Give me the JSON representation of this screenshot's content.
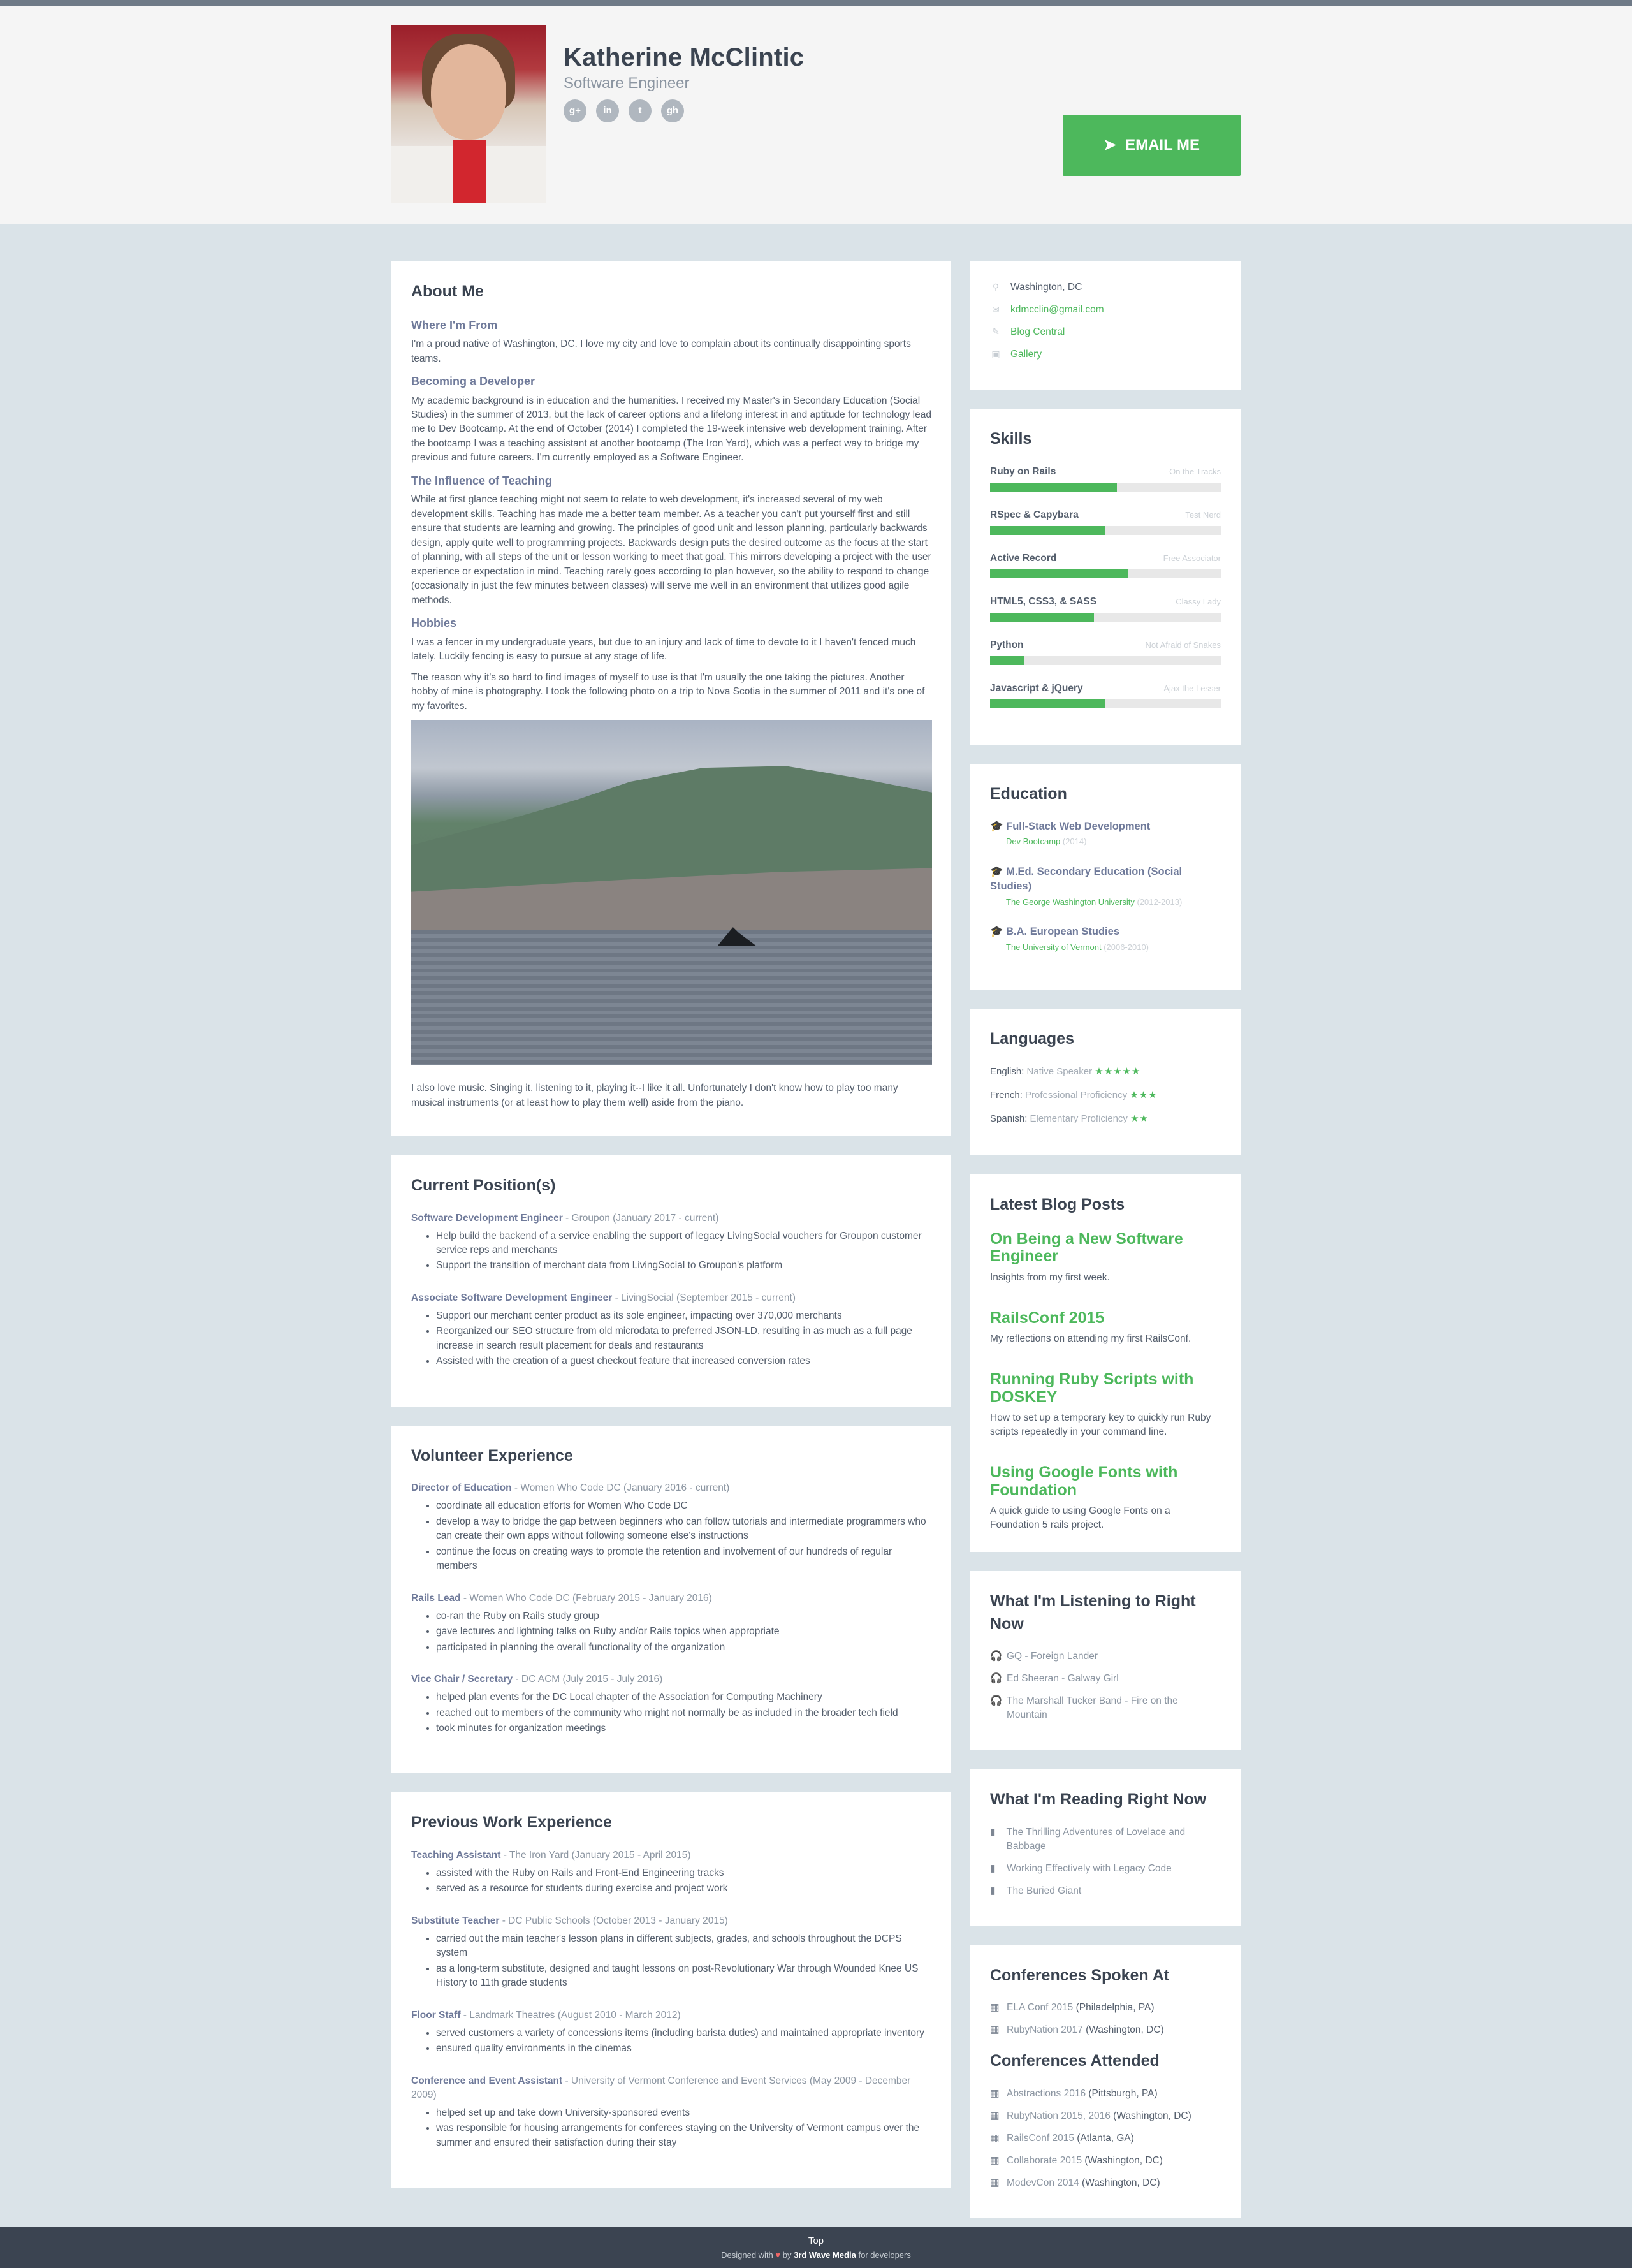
{
  "header": {
    "name": "Katherine McClintic",
    "tagline": "Software Engineer",
    "email_button": "EMAIL ME",
    "social": [
      "g+",
      "in",
      "t",
      "gh"
    ]
  },
  "about": {
    "title": "About Me",
    "sections": [
      {
        "h": "Where I'm From",
        "p": [
          "I'm a proud native of Washington, DC. I love my city and love to complain about its continually disappointing sports teams."
        ]
      },
      {
        "h": "Becoming a Developer",
        "p": [
          "My academic background is in education and the humanities. I received my Master's in Secondary Education (Social Studies) in the summer of 2013, but the lack of career options and a lifelong interest in and aptitude for technology lead me to Dev Bootcamp. At the end of October (2014) I completed the 19-week intensive web development training. After the bootcamp I was a teaching assistant at another bootcamp (The Iron Yard), which was a perfect way to bridge my previous and future careers. I'm currently employed as a Software Engineer."
        ]
      },
      {
        "h": "The Influence of Teaching",
        "p": [
          "While at first glance teaching might not seem to relate to web development, it's increased several of my web development skills. Teaching has made me a better team member. As a teacher you can't put yourself first and still ensure that students are learning and growing. The principles of good unit and lesson planning, particularly backwards design, apply quite well to programming projects. Backwards design puts the desired outcome as the focus at the start of planning, with all steps of the unit or lesson working to meet that goal. This mirrors developing a project with the user experience or expectation in mind. Teaching rarely goes according to plan however, so the ability to respond to change (occasionally in just the few minutes between classes) will serve me well in an environment that utilizes good agile methods."
        ]
      },
      {
        "h": "Hobbies",
        "p": [
          "I was a fencer in my undergraduate years, but due to an injury and lack of time to devote to it I haven't fenced much lately. Luckily fencing is easy to pursue at any stage of life.",
          "The reason why it's so hard to find images of myself to use is that I'm usually the one taking the pictures. Another hobby of mine is photography. I took the following photo on a trip to Nova Scotia in the summer of 2011 and it's one of my favorites."
        ]
      }
    ],
    "after_photo": "I also love music. Singing it, listening to it, playing it--I like it all. Unfortunately I don't know how to play too many musical instruments (or at least how to play them well) aside from the piano."
  },
  "current": {
    "title": "Current Position(s)",
    "jobs": [
      {
        "role": "Software Development Engineer",
        "org": " - Groupon (January 2017 - current)",
        "items": [
          "Help build the backend of a service enabling the support of legacy LivingSocial vouchers for Groupon customer service reps and merchants",
          "Support the transition of merchant data from LivingSocial to Groupon's platform"
        ]
      },
      {
        "role": "Associate Software Development Engineer",
        "org": " - LivingSocial (September 2015 - current)",
        "items": [
          "Support our merchant center product as its sole engineer, impacting over 370,000 merchants",
          "Reorganized our SEO structure from old microdata to preferred JSON-LD, resulting in as much as a full page increase in search result placement for deals and restaurants",
          "Assisted with the creation of a guest checkout feature that increased conversion rates"
        ]
      }
    ]
  },
  "volunteer": {
    "title": "Volunteer Experience",
    "jobs": [
      {
        "role": "Director of Education",
        "org": " - Women Who Code DC (January 2016 - current)",
        "items": [
          "coordinate all education efforts for Women Who Code DC",
          "develop a way to bridge the gap between beginners who can follow tutorials and intermediate programmers who can create their own apps without following someone else's instructions",
          "continue the focus on creating ways to promote the retention and involvement of our hundreds of regular members"
        ]
      },
      {
        "role": "Rails Lead",
        "org": " - Women Who Code DC (February 2015 - January 2016)",
        "items": [
          "co-ran the Ruby on Rails study group",
          "gave lectures and lightning talks on Ruby and/or Rails topics when appropriate",
          "participated in planning the overall functionality of the organization"
        ]
      },
      {
        "role": "Vice Chair / Secretary",
        "org": " - DC ACM (July 2015 - July 2016)",
        "items": [
          "helped plan events for the DC Local chapter of the Association for Computing Machinery",
          "reached out to members of the community who might not normally be as included in the broader tech field",
          "took minutes for organization meetings"
        ]
      }
    ]
  },
  "previous": {
    "title": "Previous Work Experience",
    "jobs": [
      {
        "role": "Teaching Assistant",
        "org": " - The Iron Yard (January 2015 - April 2015)",
        "items": [
          "assisted with the Ruby on Rails and Front-End Engineering tracks",
          "served as a resource for students during exercise and project work"
        ]
      },
      {
        "role": "Substitute Teacher",
        "org": " - DC Public Schools (October 2013 - January 2015)",
        "items": [
          "carried out the main teacher's lesson plans in different subjects, grades, and schools throughout the DCPS system",
          "as a long-term substitute, designed and taught lessons on post-Revolutionary War through Wounded Knee US History to 11th grade students"
        ]
      },
      {
        "role": "Floor Staff",
        "org": " - Landmark Theatres (August 2010 - March 2012)",
        "items": [
          "served customers a variety of concessions items (including barista duties) and maintained appropriate inventory",
          "ensured quality environments in the cinemas"
        ]
      },
      {
        "role": "Conference and Event Assistant",
        "org": " - University of Vermont Conference and Event Services (May 2009 - December 2009)",
        "items": [
          "helped set up and take down University-sponsored events",
          "was responsible for housing arrangements for conferees staying on the University of Vermont campus over the summer and ensured their satisfaction during their stay"
        ]
      }
    ]
  },
  "info": {
    "location": "Washington, DC",
    "email": "kdmcclin@gmail.com",
    "blog": "Blog Central",
    "gallery": "Gallery"
  },
  "skills": {
    "title": "Skills",
    "items": [
      {
        "name": "Ruby on Rails",
        "label": "On the Tracks",
        "level": 0.55
      },
      {
        "name": "RSpec & Capybara",
        "label": "Test Nerd",
        "level": 0.5
      },
      {
        "name": "Active Record",
        "label": "Free Associator",
        "level": 0.6
      },
      {
        "name": "HTML5, CSS3, & SASS",
        "label": "Classy Lady",
        "level": 0.45
      },
      {
        "name": "Python",
        "label": "Not Afraid of Snakes",
        "level": 0.15
      },
      {
        "name": "Javascript & jQuery",
        "label": "Ajax the Lesser",
        "level": 0.5
      }
    ]
  },
  "education": {
    "title": "Education",
    "items": [
      {
        "degree": "Full-Stack Web Development",
        "school": "Dev Bootcamp",
        "years": " (2014)"
      },
      {
        "degree": "M.Ed. Secondary Education (Social Studies)",
        "school": "The George Washington University",
        "years": " (2012-2013)"
      },
      {
        "degree": "B.A. European Studies",
        "school": "The University of Vermont",
        "years": " (2006-2010)"
      }
    ]
  },
  "languages": {
    "title": "Languages",
    "items": [
      {
        "lang": "English:",
        "level": " Native Speaker ",
        "stars": "★★★★★"
      },
      {
        "lang": "French:",
        "level": " Professional Proficiency ",
        "stars": "★★★"
      },
      {
        "lang": "Spanish:",
        "level": " Elementary Proficiency ",
        "stars": "★★"
      }
    ]
  },
  "blog": {
    "title": "Latest Blog Posts",
    "posts": [
      {
        "t": "On Being a New Software Engineer",
        "d": "Insights from my first week."
      },
      {
        "t": "RailsConf 2015",
        "d": "My reflections on attending my first RailsConf."
      },
      {
        "t": "Running Ruby Scripts with DOSKEY",
        "d": "How to set up a temporary key to quickly run Ruby scripts repeatedly in your command line."
      },
      {
        "t": "Using Google Fonts with Foundation",
        "d": "A quick guide to using Google Fonts on a Foundation 5 rails project."
      }
    ]
  },
  "listening": {
    "title": "What I'm Listening to Right Now",
    "items": [
      "GQ - Foreign Lander",
      "Ed Sheeran - Galway Girl",
      "The Marshall Tucker Band - Fire on the Mountain"
    ]
  },
  "reading": {
    "title": "What I'm Reading Right Now",
    "items": [
      "The Thrilling Adventures of Lovelace and Babbage",
      "Working Effectively with Legacy Code",
      "The Buried Giant"
    ]
  },
  "conferences": {
    "spoken_title": "Conferences Spoken At",
    "spoken": [
      {
        "name": "ELA Conf 2015",
        "place": " (Philadelphia, PA)"
      },
      {
        "name": "RubyNation 2017",
        "place": " (Washington, DC)"
      }
    ],
    "attended_title": "Conferences Attended",
    "attended": [
      {
        "name": "Abstractions 2016",
        "place": " (Pittsburgh, PA)"
      },
      {
        "name": "RubyNation 2015, 2016",
        "place": " (Washington, DC)"
      },
      {
        "name": "RailsConf 2015",
        "place": " (Atlanta, GA)"
      },
      {
        "name": "Collaborate 2015",
        "place": " (Washington, DC)"
      },
      {
        "name": "ModevCon 2014",
        "place": " (Washington, DC)"
      }
    ]
  },
  "footer": {
    "top": "Top",
    "pre": "Designed with ",
    "heart": "♥",
    "mid": " by ",
    "brand": "3rd Wave Media",
    "post": " for developers"
  }
}
